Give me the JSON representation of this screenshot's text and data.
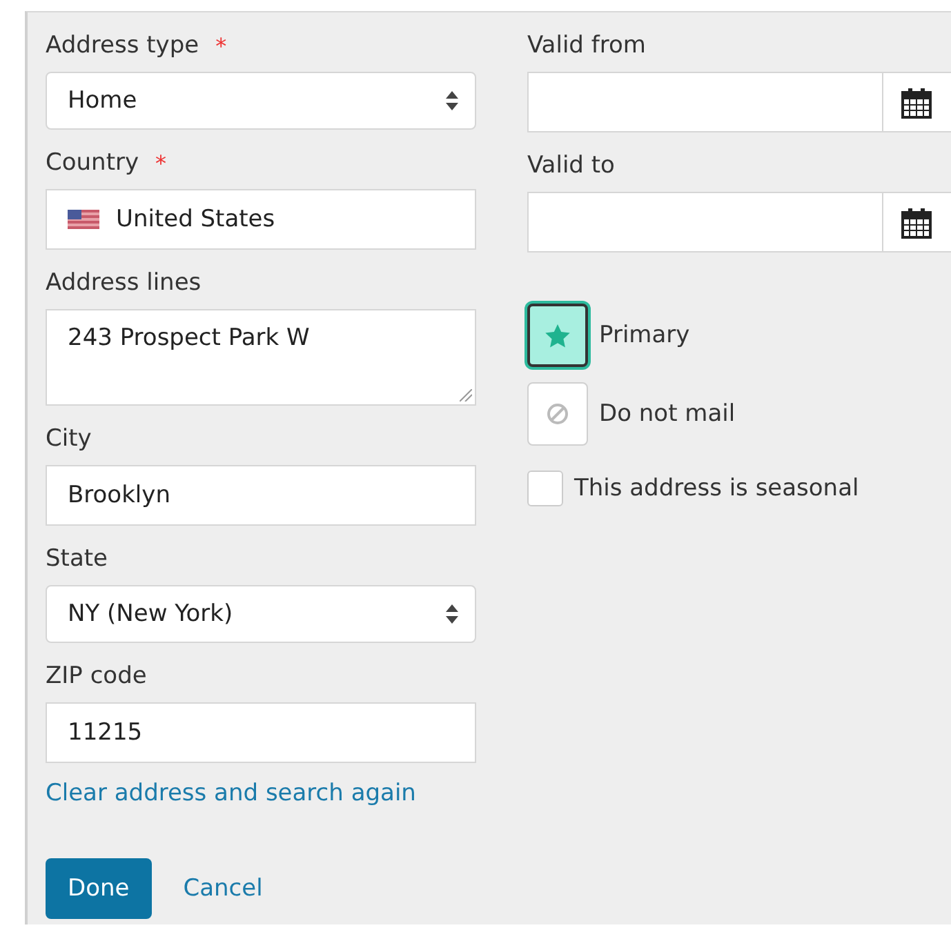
{
  "left_fields": [
    {
      "kind": "select",
      "label": "Address type",
      "required_mark": "*",
      "value": "Home"
    },
    {
      "kind": "country",
      "label": "Country",
      "required_mark": "*",
      "value": "United States"
    },
    {
      "kind": "textarea",
      "label": "Address lines",
      "value": "243 Prospect Park W"
    },
    {
      "kind": "text",
      "label": "City",
      "value": "Brooklyn"
    },
    {
      "kind": "select",
      "label": "State",
      "value": "NY (New York)"
    },
    {
      "kind": "text",
      "label": "ZIP code",
      "value": "11215"
    }
  ],
  "clear_link": "Clear address and search again",
  "date_fields": [
    {
      "label": "Valid from"
    },
    {
      "label": "Valid to"
    }
  ],
  "toggles": [
    {
      "kind": "primary",
      "label": "Primary",
      "selected": true
    },
    {
      "kind": "do-not-mail",
      "label": "Do not mail",
      "selected": false
    }
  ],
  "seasonal": {
    "label": "This address is seasonal",
    "checked": false
  },
  "buttons": {
    "done": "Done",
    "cancel": "Cancel"
  }
}
